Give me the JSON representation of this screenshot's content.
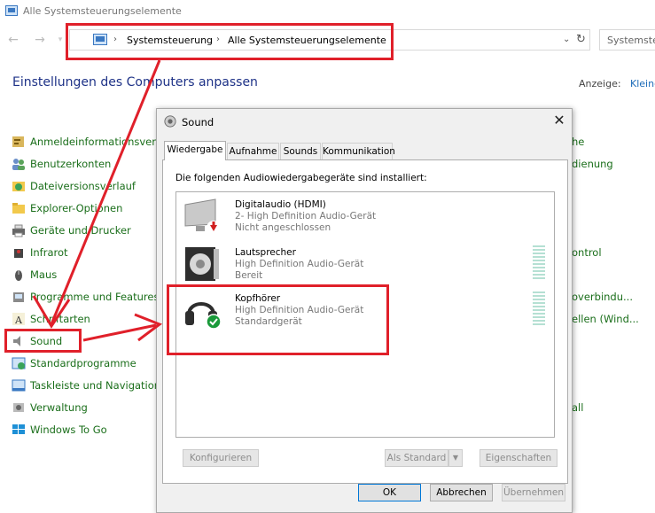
{
  "window": {
    "title": "Alle Systemsteuerungselemente"
  },
  "address_bar": {
    "segments": [
      "Systemsteuerung",
      "Alle Systemsteuerungselemente"
    ],
    "search_placeholder": "Systemste"
  },
  "heading": "Einstellungen des Computers anpassen",
  "view": {
    "label": "Anzeige:",
    "value": "Kleine"
  },
  "control_panel_items": [
    {
      "label": "Anmeldeinformationsverw",
      "icon": "credential-icon"
    },
    {
      "label": "Benutzerkonten",
      "icon": "users-icon"
    },
    {
      "label": "Dateiversionsverlauf",
      "icon": "file-history-icon"
    },
    {
      "label": "Explorer-Optionen",
      "icon": "folder-options-icon"
    },
    {
      "label": "Geräte und Drucker",
      "icon": "printer-icon"
    },
    {
      "label": "Infrarot",
      "icon": "infrared-icon"
    },
    {
      "label": "Maus",
      "icon": "mouse-icon"
    },
    {
      "label": "Programme und Features",
      "icon": "programs-icon"
    },
    {
      "label": "Schriftarten",
      "icon": "fonts-icon"
    },
    {
      "label": "Sound",
      "icon": "speaker-icon"
    },
    {
      "label": "Standardprogramme",
      "icon": "default-programs-icon"
    },
    {
      "label": "Taskleiste und Navigation",
      "icon": "taskbar-icon"
    },
    {
      "label": "Verwaltung",
      "icon": "admin-tools-icon"
    },
    {
      "label": "Windows To Go",
      "icon": "windows-icon"
    }
  ],
  "right_column_fragments": [
    "he",
    "dienung",
    "ontrol",
    "overbindu...",
    "ellen (Wind...",
    "all"
  ],
  "dialog": {
    "title": "Sound",
    "tabs": [
      "Wiedergabe",
      "Aufnahme",
      "Sounds",
      "Kommunikation"
    ],
    "label": "Die folgenden Audiowiedergabegeräte sind installiert:",
    "devices": [
      {
        "name": "Digitalaudio (HDMI)",
        "line2": "2- High Definition Audio-Gerät",
        "line3": "Nicht angeschlossen",
        "icon": "monitor-icon"
      },
      {
        "name": "Lautsprecher",
        "line2": "High Definition Audio-Gerät",
        "line3": "Bereit",
        "icon": "speaker-icon"
      },
      {
        "name": "Kopfhörer",
        "line2": "High Definition Audio-Gerät",
        "line3": "Standardgerät",
        "icon": "headphones-icon"
      }
    ],
    "buttons": {
      "configure": "Konfigurieren",
      "set_default": "Als Standard",
      "properties": "Eigenschaften",
      "ok": "OK",
      "cancel": "Abbrechen",
      "apply": "Übernehmen"
    }
  },
  "colors": {
    "annotation": "#e0202a",
    "link_green": "#1a6e1a",
    "heading_blue": "#1e3287"
  }
}
